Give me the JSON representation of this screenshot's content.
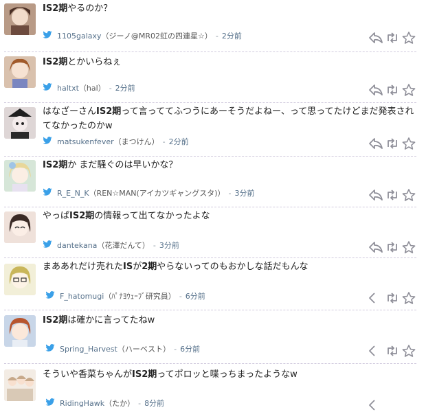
{
  "tweets": [
    {
      "before": "",
      "bold": "IS2期",
      "after": "やるのか？",
      "line2": "",
      "username": "1105galaxy",
      "display": "（ジーノ@MR02虹の四連星☆）",
      "time": "2分前",
      "avatar": "#7a5e4e",
      "hair": "#4a2f25"
    },
    {
      "before": "",
      "bold": "IS2期",
      "after": "とかいらねぇ",
      "line2": "",
      "username": "haltxt",
      "display": "（hal）",
      "time": "2分前",
      "avatar": "#c9a48a",
      "hair": "#a15a2a"
    },
    {
      "before": "はなざーさん",
      "bold": "IS2期",
      "after": "って言っててふつうにあーそうだよねー、って思ってたけどまだ発表され",
      "line2": "てなかったのかw",
      "username": "matsukenfever",
      "display": "（まつけん）",
      "time": "2分前",
      "avatar": "#d8d0d0",
      "hair": "#1f1f1f"
    },
    {
      "before": "",
      "bold": "IS2期",
      "after": "か まだ騒ぐのは早いかな？",
      "line2": "",
      "username": "R_E_N_K",
      "display": "（REN☆MAN(アイカツギャングスタ)）",
      "time": "3分前",
      "avatar": "#cfe0d0",
      "hair": "#e8d79a"
    },
    {
      "before": "やっぱ",
      "bold": "IS2期",
      "after": "の情報って出てなかったよな",
      "line2": "",
      "username": "dantekana",
      "display": "（花澤だんて）",
      "time": "3分前",
      "avatar": "#e8d6cf",
      "hair": "#3a2a25"
    },
    {
      "before": "まああれだけ売れた",
      "bold": "IS",
      "after": "が",
      "bold2": "2期",
      "after2": "やらないってのもおかしな話だもんな",
      "line2": "",
      "username": "F_hatomugi",
      "display": "（ﾊﾟﾅﾖｳｪｰﾌﾞ研究員）",
      "time": "6分前",
      "avatar": "#e9e6c8",
      "hair": "#c9b65a"
    },
    {
      "before": "",
      "bold": "IS2期",
      "after": "は確かに言ってたねw",
      "line2": "",
      "username": "Spring_Harvest",
      "display": "（ハーベスト）",
      "time": "6分前",
      "avatar": "#d9c3b8",
      "hair": "#b8562f"
    },
    {
      "before": "そういや香菜ちゃんが",
      "bold": "IS2期",
      "after": "ってポロッと喋っちまったようなw",
      "line2": "",
      "username": "RidingHawk",
      "display": "（たか）",
      "time": "8分前",
      "avatar": "#efe8e0",
      "hair": "#c7a98a"
    }
  ],
  "colors": {
    "actions": "#8f8f99",
    "bird": "#3aa0e8",
    "separator": "#cfc8dc"
  },
  "icons": {
    "reply": "reply-icon",
    "retweet": "retweet-icon",
    "favorite": "star-icon",
    "bird": "bird-icon"
  }
}
